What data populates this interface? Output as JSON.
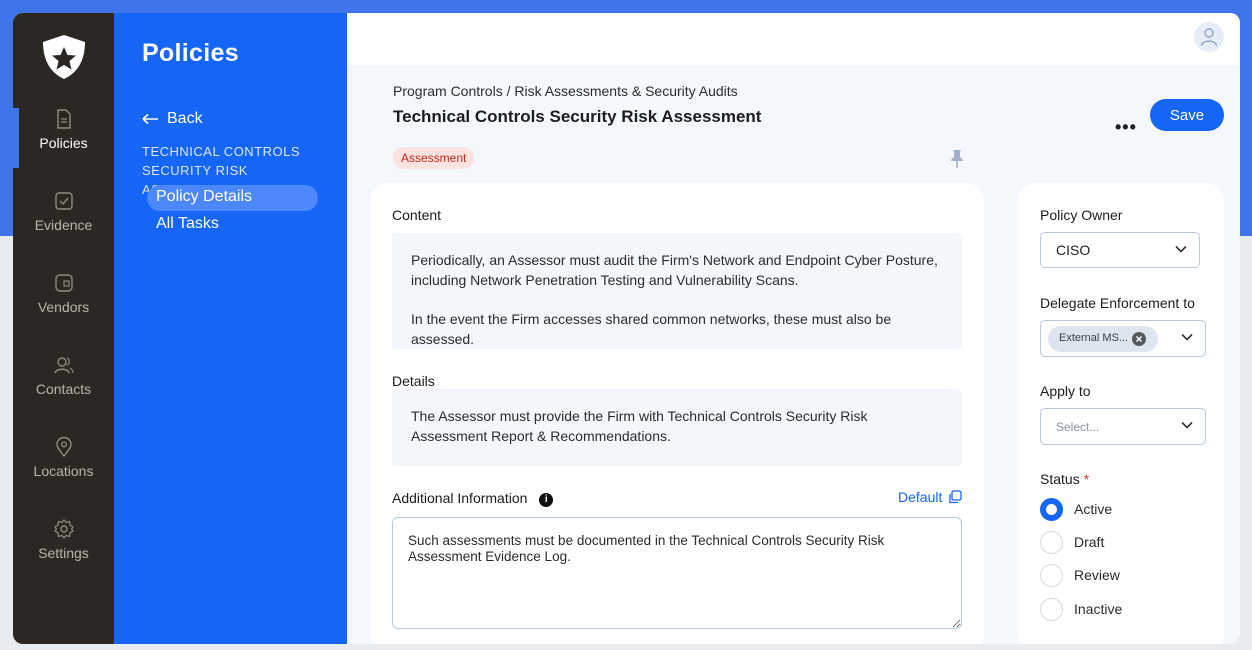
{
  "rail": {
    "items": [
      {
        "label": "Policies",
        "icon": "document-icon",
        "active": true
      },
      {
        "label": "Evidence",
        "icon": "checkbox-icon",
        "active": false
      },
      {
        "label": "Vendors",
        "icon": "vendor-card-icon",
        "active": false
      },
      {
        "label": "Contacts",
        "icon": "contacts-icon",
        "active": false
      },
      {
        "label": "Locations",
        "icon": "location-pin-icon",
        "active": false
      },
      {
        "label": "Settings",
        "icon": "gear-icon",
        "active": false
      }
    ]
  },
  "subnav": {
    "title": "Policies",
    "back_label": "Back",
    "section_label": "TECHNICAL CONTROLS SECURITY RISK ASSESSMENT",
    "items": [
      {
        "label": "Policy Details",
        "active": true
      },
      {
        "label": "All Tasks",
        "active": false
      }
    ]
  },
  "header": {
    "breadcrumb": "Program Controls / Risk Assessments & Security Audits",
    "title": "Technical Controls Security Risk Assessment",
    "more_label": "•••",
    "save_label": "Save",
    "tag": "Assessment"
  },
  "content": {
    "content_label": "Content",
    "content_paragraph_1": "Periodically, an Assessor must audit the Firm's Network and Endpoint Cyber Posture, including Network Penetration Testing and Vulnerability Scans.",
    "content_paragraph_2": "In the event the Firm accesses shared common networks, these must also be assessed.",
    "details_label": "Details",
    "details_text": "The Assessor must provide the Firm with Technical Controls Security Risk Assessment Report & Recommendations.",
    "additional_label": "Additional Information",
    "info_icon": "i",
    "default_label": "Default",
    "additional_text": "Such assessments must be documented in the Technical Controls Security Risk Assessment Evidence Log."
  },
  "sidebar": {
    "policy_owner_label": "Policy Owner",
    "policy_owner_value": "CISO",
    "delegate_label": "Delegate Enforcement to",
    "delegate_chip": "External MS...",
    "apply_label": "Apply to",
    "apply_placeholder": "Select...",
    "status_label": "Status",
    "status_required": "*",
    "status_options": [
      {
        "label": "Active",
        "selected": true
      },
      {
        "label": "Draft",
        "selected": false
      },
      {
        "label": "Review",
        "selected": false
      },
      {
        "label": "Inactive",
        "selected": false
      }
    ]
  },
  "colors": {
    "accent": "#1565f6",
    "rail": "#2b2824",
    "tag_text": "#c2271c",
    "tag_bg": "#fce3e0"
  }
}
